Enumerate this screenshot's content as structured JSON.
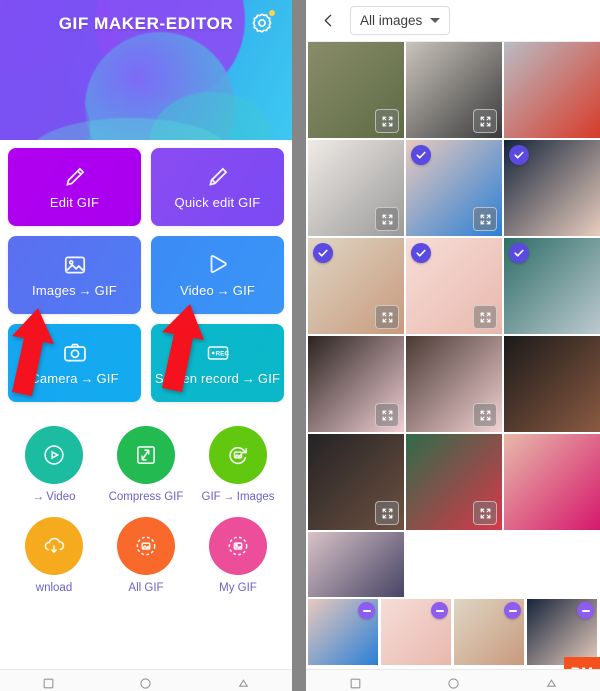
{
  "left_app": {
    "title": "GIF MAKER-EDITOR",
    "settings_icon": "gear-icon",
    "tiles": [
      {
        "label": "Edit GIF",
        "icon": "brush-icon",
        "color": "#b200f0"
      },
      {
        "label": "Quick edit GIF",
        "icon": "brush-icon",
        "color": "#8a4cf2"
      },
      {
        "label": "Images → GIF",
        "icon": "picture-icon",
        "color": "#5b6ff0"
      },
      {
        "label": "Video → GIF",
        "icon": "play-icon",
        "color": "#3b8bf5"
      },
      {
        "label": "Camera → GIF",
        "icon": "camera-icon",
        "color": "#16a6f0"
      },
      {
        "label": "Screen record → GIF",
        "icon": "rec-icon",
        "color": "#0cb6cd"
      }
    ],
    "circles": [
      {
        "label": "→ Video",
        "icon": "gif-to-video-icon",
        "color": "#1bbca0"
      },
      {
        "label": "Compress GIF",
        "icon": "compress-icon",
        "color": "#22ba51"
      },
      {
        "label": "GIF → Images",
        "icon": "gif-to-images-icon",
        "color": "#62c80f"
      },
      {
        "label": "wnload",
        "icon": "cloud-download-icon",
        "color": "#f5ab1d"
      },
      {
        "label": "All GIF",
        "icon": "all-gif-icon",
        "color": "#f9692c"
      },
      {
        "label": "My GIF",
        "icon": "my-gif-icon",
        "color": "#ec4e9a"
      }
    ],
    "annotations": [
      {
        "name": "red-arrow-images-to-gif",
        "color": "#f5121f"
      },
      {
        "name": "red-arrow-video-to-gif",
        "color": "#f5121f"
      }
    ]
  },
  "gallery": {
    "back_icon": "chevron-left-icon",
    "album": {
      "label": "All images",
      "caret_icon": "chevron-down-icon"
    },
    "check_color": "#5b4ae0",
    "remove_color": "#8f5cf0",
    "cells": [
      {
        "name": "photo-camo-jacket",
        "selected": false,
        "expand": true,
        "c1": "#8a8c6a",
        "c2": "#5d6b45"
      },
      {
        "name": "photo-child-black-outfit",
        "selected": false,
        "expand": true,
        "c1": "#c9c4bb",
        "c2": "#3a3a3c"
      },
      {
        "name": "photo-child-red-top",
        "selected": false,
        "expand": false,
        "c1": "#b9bcc4",
        "c2": "#d83b2a"
      },
      {
        "name": "photo-baby-alpha-female",
        "selected": false,
        "expand": true,
        "c1": "#efeae6",
        "c2": "#9a9a9a"
      },
      {
        "name": "photo-baby-blue-bow",
        "selected": true,
        "expand": true,
        "c1": "#e8c9bd",
        "c2": "#2a7fd6"
      },
      {
        "name": "photo-baby-white-headband",
        "selected": true,
        "expand": false,
        "c1": "#16243a",
        "c2": "#e8cdbe"
      },
      {
        "name": "photo-baby-i-love-daddy",
        "selected": true,
        "expand": true,
        "c1": "#ded5c4",
        "c2": "#c89a7c"
      },
      {
        "name": "photo-baby-pink-headband",
        "selected": true,
        "expand": true,
        "c1": "#f6ddd8",
        "c2": "#e8b8ac"
      },
      {
        "name": "photo-baby-knit-hat",
        "selected": true,
        "expand": false,
        "c1": "#2f6e68",
        "c2": "#bcc9cf"
      },
      {
        "name": "photo-baby-white-beanie",
        "selected": false,
        "expand": true,
        "c1": "#2b2320",
        "c2": "#f2cfd4"
      },
      {
        "name": "photo-baby-pink-towel",
        "selected": false,
        "expand": true,
        "c1": "#4a3a34",
        "c2": "#f3d2d4"
      },
      {
        "name": "photo-man-portrait-1",
        "selected": false,
        "expand": false,
        "c1": "#1a1a1a",
        "c2": "#8a5a42"
      },
      {
        "name": "photo-man-suit",
        "selected": false,
        "expand": true,
        "c1": "#232326",
        "c2": "#6e5040"
      },
      {
        "name": "photo-girl-striped-shirt",
        "selected": false,
        "expand": true,
        "c1": "#2f6b4a",
        "c2": "#d8384a"
      },
      {
        "name": "photo-baby-magenta-headband",
        "selected": false,
        "expand": false,
        "c1": "#e7b9aa",
        "c2": "#d6186b"
      },
      {
        "name": "photo-baby-navy-bow",
        "selected": false,
        "expand": false,
        "c1": "#d8c2c6",
        "c2": "#2b2c52"
      }
    ],
    "selected_strip": [
      {
        "name": "thumb-baby-blue-bow",
        "c1": "#e8c9bd",
        "c2": "#2a7fd6"
      },
      {
        "name": "thumb-baby-pink-headband",
        "c1": "#f6ddd8",
        "c2": "#e8b8ac"
      },
      {
        "name": "thumb-baby-i-love-daddy",
        "c1": "#ded5c4",
        "c2": "#c89a7c"
      },
      {
        "name": "thumb-baby-white-headband",
        "c1": "#16243a",
        "c2": "#e8cdbe"
      },
      {
        "name": "thumb-baby-knit-hat",
        "c1": "#2f6e68",
        "c2": "#bcc9cf"
      }
    ],
    "watermark": "RM"
  }
}
